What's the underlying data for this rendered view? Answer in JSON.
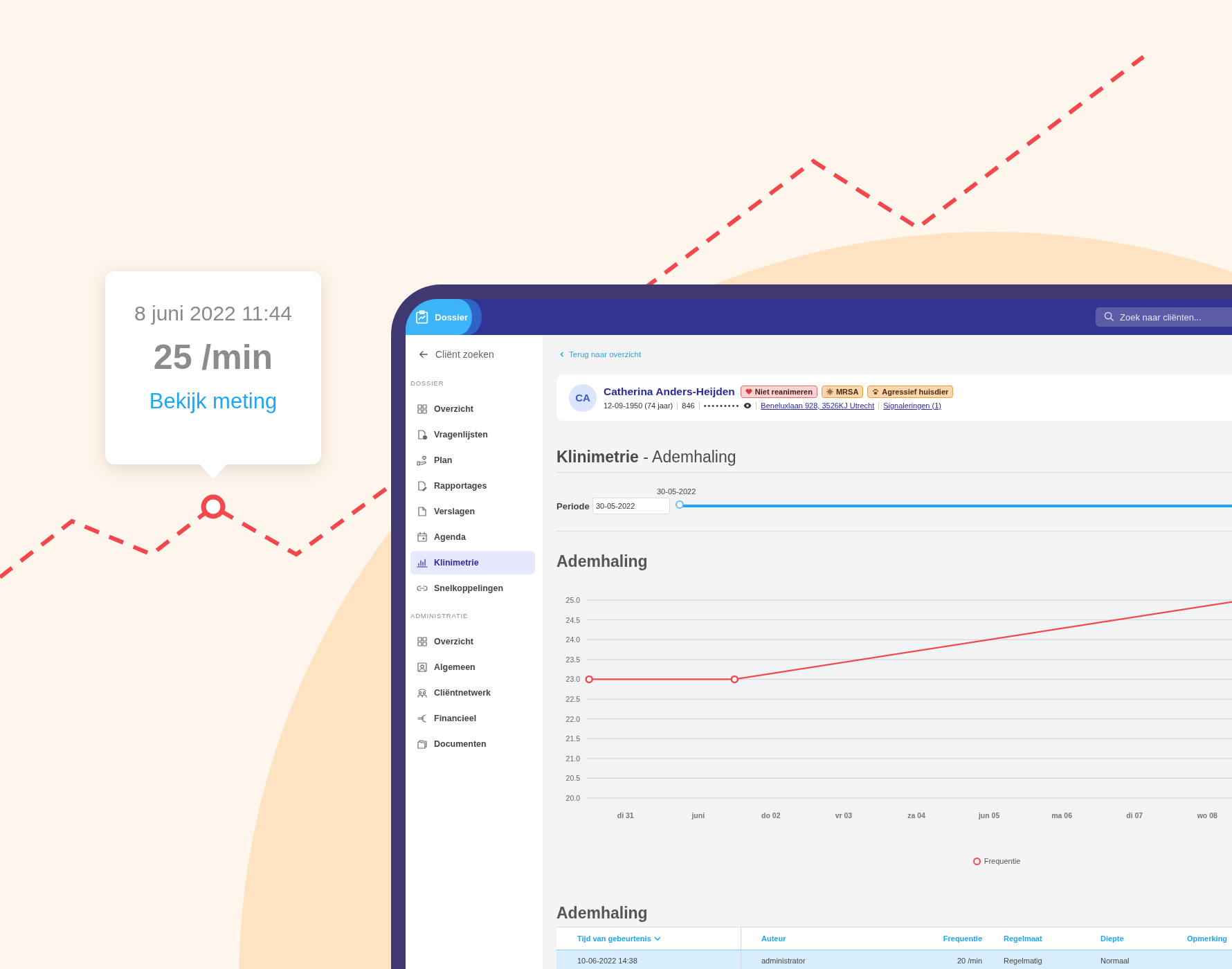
{
  "tooltip": {
    "datetime": "8 juni 2022 11:44",
    "value": "25 /min",
    "link": "Bekijk meting"
  },
  "header": {
    "tab": "Dossier",
    "search_placeholder": "Zoek naar cliënten..."
  },
  "sidebar": {
    "back": "Cliënt zoeken",
    "sections": [
      {
        "title": "DOSSIER",
        "items": [
          {
            "label": "Overzicht",
            "selected": false
          },
          {
            "label": "Vragenlijsten",
            "selected": false
          },
          {
            "label": "Plan",
            "selected": false
          },
          {
            "label": "Rapportages",
            "selected": false
          },
          {
            "label": "Verslagen",
            "selected": false
          },
          {
            "label": "Agenda",
            "selected": false
          },
          {
            "label": "Klinimetrie",
            "selected": true
          },
          {
            "label": "Snelkoppelingen",
            "selected": false
          }
        ]
      },
      {
        "title": "ADMINISTRATIE",
        "items": [
          {
            "label": "Overzicht",
            "selected": false
          },
          {
            "label": "Algemeen",
            "selected": false
          },
          {
            "label": "Cliëntnetwerk",
            "selected": false
          },
          {
            "label": "Financieel",
            "selected": false
          },
          {
            "label": "Documenten",
            "selected": false
          }
        ]
      }
    ]
  },
  "back_link": "Terug naar overzicht",
  "patient": {
    "initials": "CA",
    "name": "Catherina Anders-Heijden",
    "badges": [
      {
        "label": "Niet reanimeren",
        "kind": "danger"
      },
      {
        "label": "MRSA",
        "kind": "warning"
      },
      {
        "label": "Agressief huisdier",
        "kind": "warning"
      }
    ],
    "birth": "12-09-1950 (74 jaar)",
    "number": "846",
    "masked": "•••••••••",
    "address": "Beneluxlaan 928, 3526KJ Utrecht",
    "signals": "Signaleringen (1)"
  },
  "page_title": "**Klinimetrie** - Ademhaling",
  "period": {
    "label": "Periode",
    "date": "30-05-2022",
    "slider_label": "30-05-2022",
    "level": 0
  },
  "chart_section": {
    "title": "Ademhaling",
    "chart_data": {
      "type": "line",
      "grid": true,
      "categories": [
        null,
        "di 31",
        null,
        "juni",
        null,
        "do 02",
        null,
        "vr 03",
        null,
        "za 04",
        null,
        "jun 05",
        null,
        "ma 06",
        null,
        "di 07",
        null,
        "wo 08",
        null
      ],
      "ylim": [
        20,
        25
      ],
      "yticks": [
        {
          "value": 20,
          "label": "20.0"
        },
        {
          "value": 20.5,
          "label": "20.5"
        },
        {
          "value": 21,
          "label": "21.0"
        },
        {
          "value": 21.5,
          "label": "21.5"
        },
        {
          "value": 22,
          "label": "22.0"
        },
        {
          "value": 22.5,
          "label": "22.5"
        },
        {
          "value": 23,
          "label": "23.0"
        },
        {
          "value": 23.5,
          "label": "23.5"
        },
        {
          "value": 24,
          "label": "24.0"
        },
        {
          "value": 24.5,
          "label": "24.5"
        },
        {
          "value": 25,
          "label": "25.0"
        }
      ],
      "series": [
        {
          "name": "Frequentie",
          "color": "#f04a4f",
          "values": [
            23,
            null,
            null,
            null,
            23,
            null,
            null,
            null,
            null,
            null,
            null,
            null,
            null,
            null,
            null,
            null,
            null,
            null,
            25
          ]
        }
      ]
    }
  },
  "table_section": {
    "title": "Ademhaling",
    "columns": [
      {
        "label": "Tijd van gebeurtenis",
        "sorted": true
      },
      {
        "label": "Auteur",
        "sorted": false
      },
      {
        "label": "Frequentie",
        "sorted": false
      },
      {
        "label": "Regelmaat",
        "sorted": false
      },
      {
        "label": "Diepte",
        "sorted": false
      },
      {
        "label": "Opmerking",
        "sorted": false
      }
    ],
    "rows": [
      {
        "selected": true,
        "cells": [
          "10-06-2022 14:38",
          "administrator",
          "20 /min",
          "Regelmatig",
          "Normaal"
        ]
      }
    ]
  }
}
